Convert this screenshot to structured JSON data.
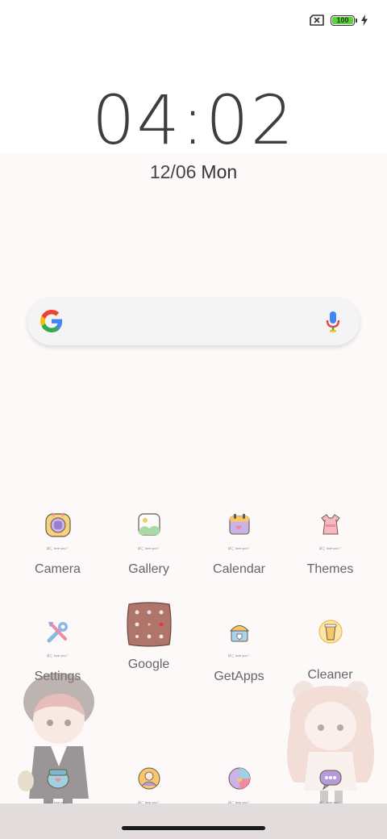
{
  "status_bar": {
    "battery_level": "100",
    "battery_fill_fraction": 1.0,
    "charging": true
  },
  "clock": {
    "time": "04:02",
    "date": "12/06",
    "day": "Mon"
  },
  "search": {
    "brand": "Google"
  },
  "apps": [
    {
      "label": "Camera"
    },
    {
      "label": "Gallery"
    },
    {
      "label": "Calendar"
    },
    {
      "label": "Themes"
    },
    {
      "label": "Settings"
    },
    {
      "label": "Google"
    },
    {
      "label": "GetApps"
    },
    {
      "label": "Cleaner"
    }
  ],
  "icon_tag": "ぼこ love you♡",
  "colors": {
    "battery": "#5cd13b",
    "text": "#555555",
    "navbar": "#e3dcdc"
  }
}
